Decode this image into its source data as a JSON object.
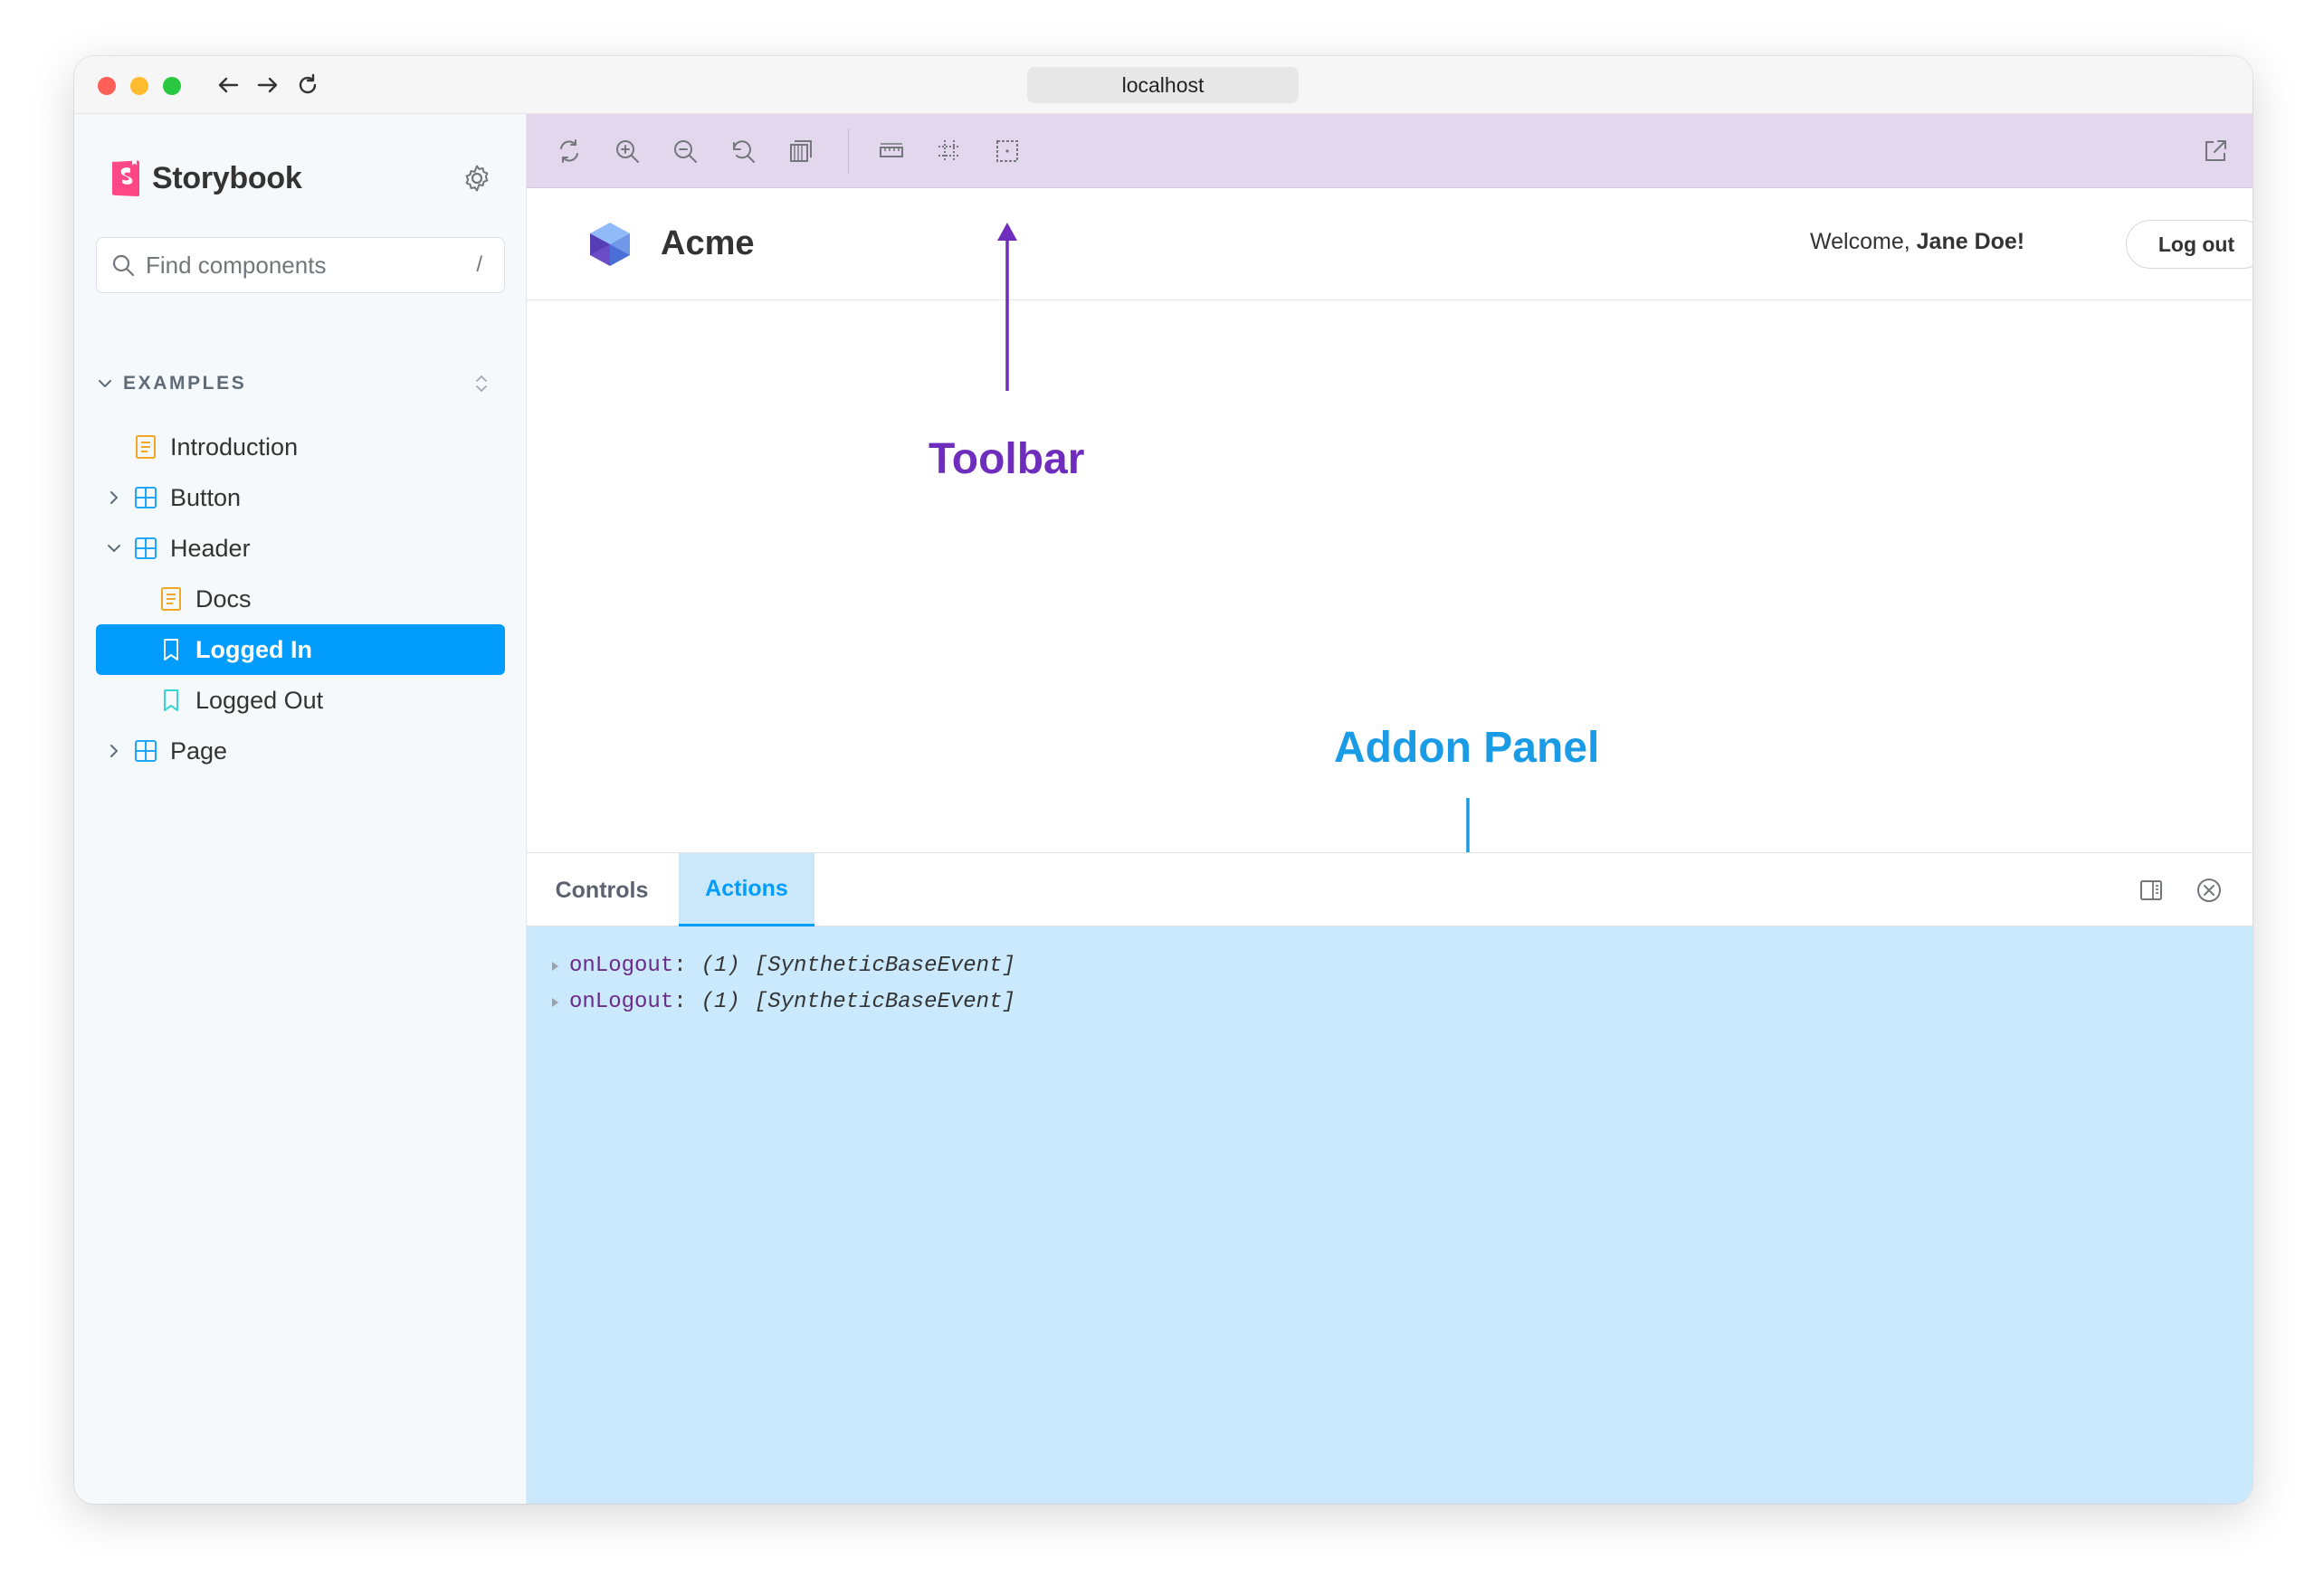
{
  "browser": {
    "address": "localhost"
  },
  "sidebar": {
    "brand": "Storybook",
    "search": {
      "placeholder": "Find components",
      "shortcut": "/"
    },
    "section": "EXAMPLES",
    "items": [
      {
        "label": "Introduction",
        "type": "doc",
        "level": 1
      },
      {
        "label": "Button",
        "type": "component",
        "level": 1,
        "expanded": false
      },
      {
        "label": "Header",
        "type": "component",
        "level": 1,
        "expanded": true
      },
      {
        "label": "Docs",
        "type": "doc",
        "level": 2
      },
      {
        "label": "Logged In",
        "type": "story",
        "level": 2,
        "selected": true
      },
      {
        "label": "Logged Out",
        "type": "story",
        "level": 2
      },
      {
        "label": "Page",
        "type": "component",
        "level": 1,
        "expanded": false
      }
    ]
  },
  "toolbar": {
    "buttons": [
      {
        "icon": "sync-icon"
      },
      {
        "icon": "zoom-in-icon"
      },
      {
        "icon": "zoom-out-icon"
      },
      {
        "icon": "zoom-reset-icon"
      },
      {
        "icon": "background-icon"
      },
      {
        "icon": "measure-icon"
      },
      {
        "icon": "grid-icon"
      },
      {
        "icon": "outline-icon"
      },
      {
        "icon": "share-icon"
      }
    ]
  },
  "preview": {
    "app_name": "Acme",
    "welcome_prefix": "Welcome, ",
    "user_name": "Jane Doe!",
    "logout_label": "Log out"
  },
  "annotations": {
    "toolbar": "Toolbar",
    "addon_panel": "Addon Panel"
  },
  "panel": {
    "tabs": [
      {
        "label": "Controls",
        "active": false
      },
      {
        "label": "Actions",
        "active": true
      }
    ],
    "log": [
      {
        "name": "onLogout",
        "count": "(1)",
        "value": "[SyntheticBaseEvent]"
      },
      {
        "name": "onLogout",
        "count": "(1)",
        "value": "[SyntheticBaseEvent]"
      }
    ]
  },
  "colors": {
    "selection": "#029cfd",
    "toolbar_highlight": "#e3d7ee",
    "panel_highlight": "#cbe9fc",
    "toolbar_annotation": "#6f2dbd",
    "addon_annotation": "#1a9be6"
  }
}
